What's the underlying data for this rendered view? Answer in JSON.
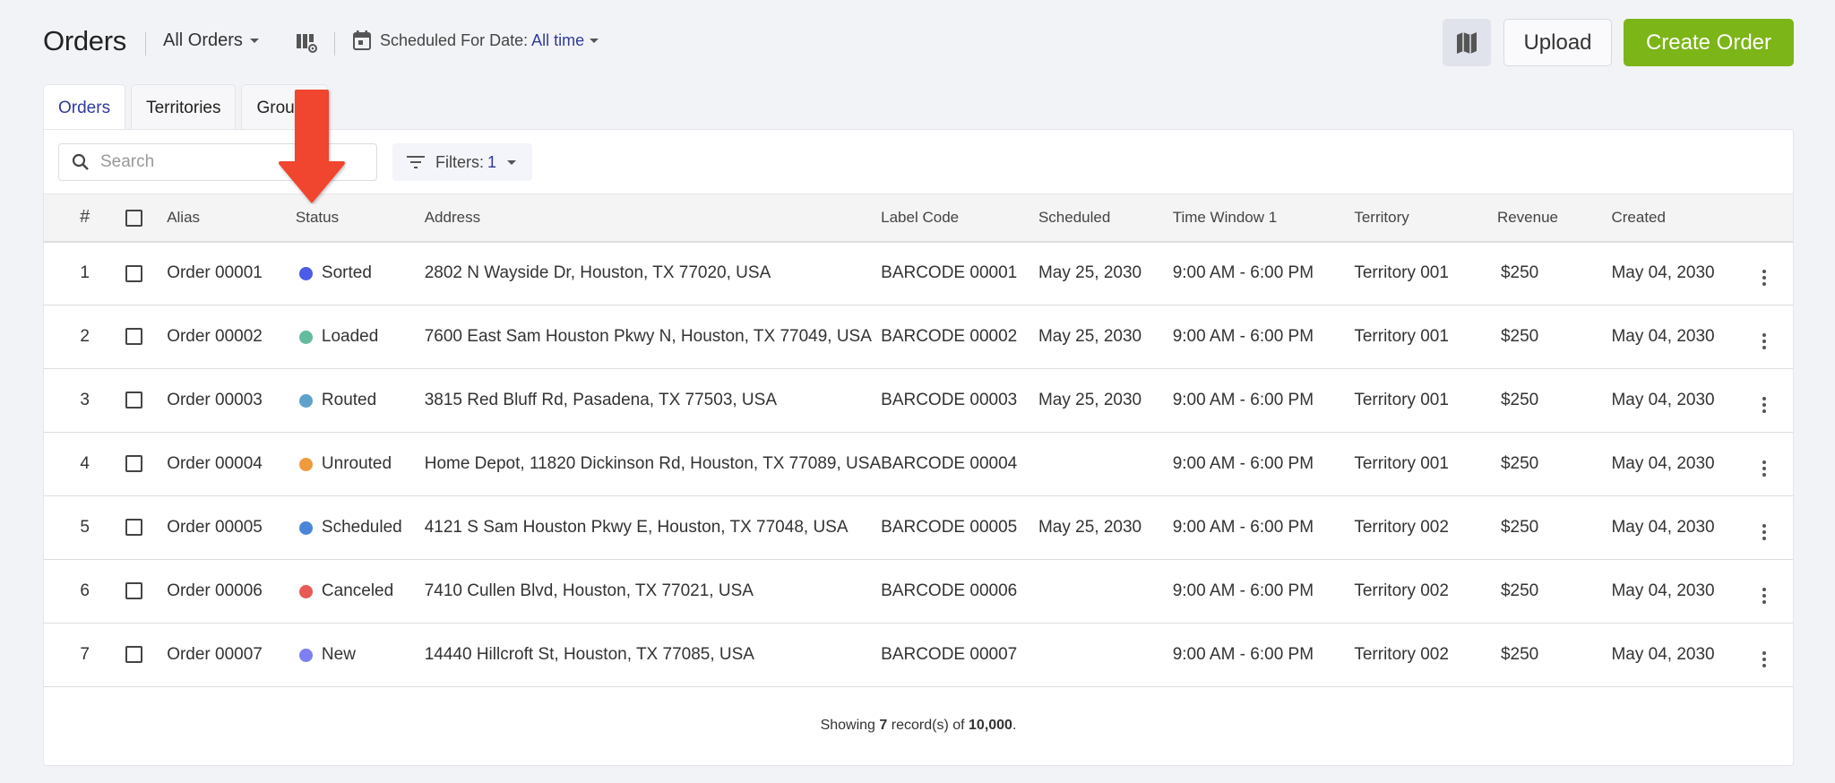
{
  "header": {
    "title": "Orders",
    "view_select": "All Orders",
    "date_filter_label": "Scheduled For Date:",
    "date_filter_value": "All time",
    "upload_label": "Upload",
    "create_label": "Create Order",
    "accent_color": "#7cb518"
  },
  "tabs": [
    {
      "label": "Orders",
      "active": true
    },
    {
      "label": "Territories",
      "active": false
    },
    {
      "label": "Groups",
      "active": false
    }
  ],
  "toolbar": {
    "search_placeholder": "Search",
    "search_value": "",
    "filters_label": "Filters:",
    "filters_count": "1"
  },
  "table": {
    "columns": [
      "#",
      "",
      "Alias",
      "Status",
      "Address",
      "Label Code",
      "Scheduled",
      "Time Window 1",
      "Territory",
      "Revenue",
      "Created",
      ""
    ],
    "rows": [
      {
        "num": "1",
        "alias": "Order 00001",
        "status": "Sorted",
        "status_color": "#4a5be8",
        "address": "2802 N Wayside Dr, Houston, TX 77020, USA",
        "label_code": "BARCODE 00001",
        "scheduled": "May 25, 2030",
        "time_window": "9:00 AM - 6:00 PM",
        "territory": "Territory 001",
        "revenue": "$250",
        "created": "May 04, 2030"
      },
      {
        "num": "2",
        "alias": "Order 00002",
        "status": "Loaded",
        "status_color": "#66bb9e",
        "address": "7600 East Sam Houston Pkwy N, Houston, TX 77049, USA",
        "label_code": "BARCODE 00002",
        "scheduled": "May 25, 2030",
        "time_window": "9:00 AM - 6:00 PM",
        "territory": "Territory 001",
        "revenue": "$250",
        "created": "May 04, 2030"
      },
      {
        "num": "3",
        "alias": "Order 00003",
        "status": "Routed",
        "status_color": "#5ea2cc",
        "address": "3815 Red Bluff Rd, Pasadena, TX 77503, USA",
        "label_code": "BARCODE 00003",
        "scheduled": "May 25, 2030",
        "time_window": "9:00 AM - 6:00 PM",
        "territory": "Territory 001",
        "revenue": "$250",
        "created": "May 04, 2030"
      },
      {
        "num": "4",
        "alias": "Order 00004",
        "status": "Unrouted",
        "status_color": "#f09a3e",
        "address": "Home Depot, 11820 Dickinson Rd, Houston, TX 77089, USA",
        "label_code": "BARCODE 00004",
        "scheduled": "",
        "time_window": "9:00 AM - 6:00 PM",
        "territory": "Territory 001",
        "revenue": "$250",
        "created": "May 04, 2030"
      },
      {
        "num": "5",
        "alias": "Order 00005",
        "status": "Scheduled",
        "status_color": "#4a86d8",
        "address": "4121 S Sam Houston Pkwy E, Houston, TX 77048, USA",
        "label_code": "BARCODE 00005",
        "scheduled": "May 25, 2030",
        "time_window": "9:00 AM - 6:00 PM",
        "territory": "Territory 002",
        "revenue": "$250",
        "created": "May 04, 2030"
      },
      {
        "num": "6",
        "alias": "Order 00006",
        "status": "Canceled",
        "status_color": "#e85a56",
        "address": "7410 Cullen Blvd, Houston, TX 77021, USA",
        "label_code": "BARCODE 00006",
        "scheduled": "",
        "time_window": "9:00 AM - 6:00 PM",
        "territory": "Territory 002",
        "revenue": "$250",
        "created": "May 04, 2030"
      },
      {
        "num": "7",
        "alias": "Order 00007",
        "status": "New",
        "status_color": "#7d80f0",
        "address": "14440 Hillcroft St, Houston, TX 77085, USA",
        "label_code": "BARCODE 00007",
        "scheduled": "",
        "time_window": "9:00 AM - 6:00 PM",
        "territory": "Territory 002",
        "revenue": "$250",
        "created": "May 04, 2030"
      }
    ]
  },
  "footer": {
    "prefix": "Showing",
    "shown": "7",
    "middle": "record(s) of",
    "total": "10,000",
    "suffix": "."
  },
  "annotation": {
    "arrow_color": "#f0452f"
  }
}
